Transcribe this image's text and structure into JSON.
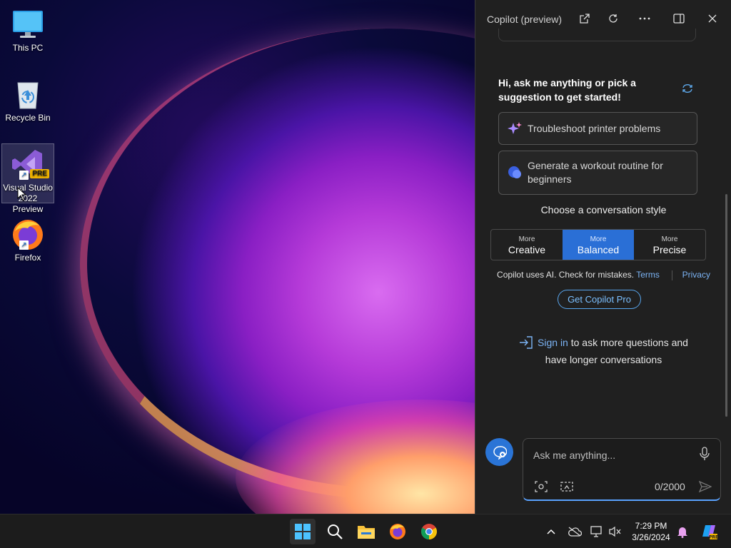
{
  "desktop": {
    "icons": [
      {
        "label": "This PC",
        "icon": "monitor-icon"
      },
      {
        "label": "Recycle Bin",
        "icon": "recycle-bin-icon"
      },
      {
        "label_line1": "Visual Studio",
        "label_line2": "2022 Preview",
        "badge": "PRE",
        "icon": "visual-studio-icon"
      },
      {
        "label": "Firefox",
        "icon": "firefox-icon"
      }
    ]
  },
  "copilot": {
    "title": "Copilot (preview)",
    "greeting": "Hi, ask me anything or pick a suggestion to get started!",
    "suggestions": [
      {
        "label": "Troubleshoot printer problems",
        "icon": "sparkle-icon"
      },
      {
        "label": "Generate a workout routine for beginners",
        "icon": "chat-bubble-icon"
      }
    ],
    "style_title": "Choose a conversation style",
    "styles": [
      {
        "small": "More",
        "big": "Creative",
        "active": false
      },
      {
        "small": "More",
        "big": "Balanced",
        "active": true
      },
      {
        "small": "More",
        "big": "Precise",
        "active": false
      }
    ],
    "disclaimer": "Copilot uses AI. Check for mistakes.",
    "terms": "Terms",
    "privacy": "Privacy",
    "pro_button": "Get Copilot Pro",
    "signin_link": "Sign in",
    "signin_line1": "to ask more questions and",
    "signin_line2": "have longer conversations",
    "input_placeholder": "Ask me anything...",
    "char_count": "0/2000",
    "accent": "#2a6fd6"
  },
  "taskbar": {
    "apps": [
      "windows-start-icon",
      "search-icon",
      "file-explorer-icon",
      "firefox-icon",
      "chrome-icon"
    ],
    "time": "7:29 PM",
    "date": "3/26/2024"
  }
}
